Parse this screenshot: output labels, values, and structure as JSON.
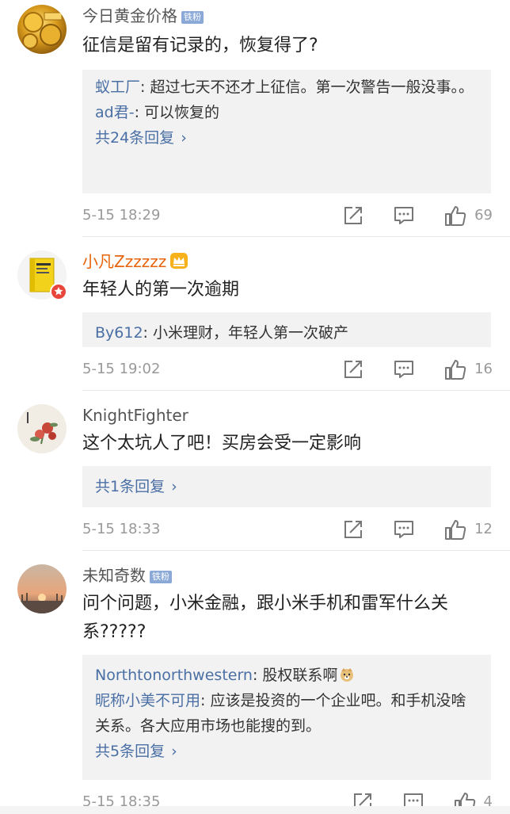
{
  "comments": [
    {
      "user": "今日黄金价格",
      "badge": "铁粉",
      "text": "征信是留有记录的，恢复得了?",
      "replies": [
        {
          "name": "蚁工厂",
          "text": ": 超过七天不还才上征信。第一次警告一般没事。。"
        },
        {
          "name": "ad君-",
          "text": ": 可以恢复的"
        }
      ],
      "more": "共24条回复",
      "time": "5-15 18:29",
      "likes": "69"
    },
    {
      "user": "小凡Zzzzzz",
      "text": "年轻人的第一次逾期",
      "replies": [
        {
          "name": "By612",
          "text": ": 小米理财，年轻人第一次破产"
        }
      ],
      "time": "5-15 19:02",
      "likes": "16"
    },
    {
      "user": "KnightFighter",
      "text": "这个太坑人了吧！买房会受一定影响",
      "more": "共1条回复",
      "time": "5-15 18:33",
      "likes": "12"
    },
    {
      "user": "未知奇数",
      "badge": "铁粉",
      "text": "问个问题，小米金融，跟小米手机和雷军什么关系?????",
      "replies": [
        {
          "name": "Northtonorthwestern",
          "text": ": 股权联系啊"
        },
        {
          "name": "昵称小美不可用",
          "text": ": 应该是投资的一个企业吧。和手机没啥关系。各大应用市场也能搜的到。"
        }
      ],
      "more": "共5条回复",
      "time": "5-15 18:35",
      "likes": "4"
    }
  ],
  "colors": {
    "link": "#4a6fa5",
    "vip_name": "#e8630a",
    "meta": "#999999",
    "reply_bg": "#f2f2f2"
  },
  "icons": [
    "share-icon",
    "comment-icon",
    "like-icon",
    "crown-icon",
    "doge-emoji-icon",
    "chevron-right-icon"
  ]
}
